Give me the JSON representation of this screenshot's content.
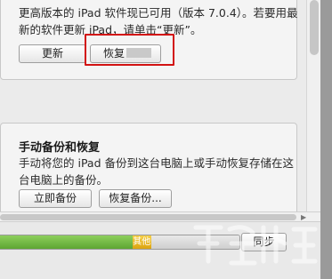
{
  "update_section": {
    "line1": "更高版本的 iPad 软件现已可用（版本 7.0.4）。若要用最",
    "line2": "新的软件更新 iPad，请单击“更新”。",
    "update_button": "更新",
    "restore_button": "恢复"
  },
  "backup_section": {
    "heading": "手动备份和恢复",
    "line1": "手动将您的 iPad 备份到这台电脑上或手动恢复存储在这",
    "line2": "台电脑上的备份。",
    "backup_now_button": "立即备份",
    "restore_backup_button": "恢复备份..."
  },
  "status_bar": {
    "capacity": {
      "app_fraction": 0.55,
      "other_fraction": 0.08,
      "other_label": "其他"
    },
    "sync_button": "同步"
  },
  "colors": {
    "highlight": "#d21212",
    "app_segment": "#6cb33f",
    "other_segment": "#e8b62a"
  }
}
